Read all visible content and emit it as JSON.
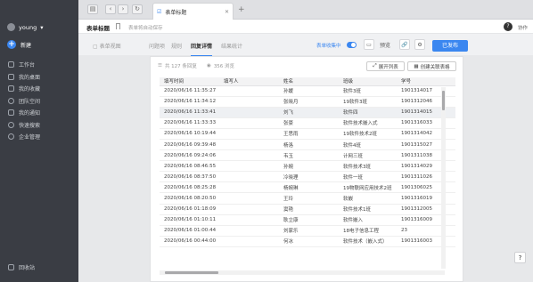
{
  "sidebar": {
    "username": "young",
    "new_label": "新建",
    "items": [
      {
        "label": "工作台",
        "icon": "workbench-icon"
      },
      {
        "label": "我的桌面",
        "icon": "desktop-icon"
      },
      {
        "label": "我的收藏",
        "icon": "star-icon"
      },
      {
        "label": "团队空间",
        "icon": "team-icon"
      },
      {
        "label": "我的通知",
        "icon": "bell-icon"
      },
      {
        "label": "快速搜索",
        "icon": "search-icon"
      },
      {
        "label": "企业管理",
        "icon": "gear-icon"
      }
    ],
    "recycle_label": "回收站"
  },
  "topbar": {
    "tab_title": "表单标题"
  },
  "header": {
    "form_title": "表单标题",
    "autosave": "表单将自动保存",
    "collab": "协作"
  },
  "subbar": {
    "tabs": [
      "表单视图",
      "问题项",
      "规则",
      "回复详情",
      "结果统计"
    ],
    "status": "表单收集中",
    "preview": "预览",
    "publish": "已发布"
  },
  "panel": {
    "total": "共 127 条回复",
    "views": "356 浏览",
    "expand": "展开列表",
    "create_table": "创建关联表格"
  },
  "table": {
    "columns": [
      "填写时间",
      "填写人",
      "姓名",
      "班级",
      "学号"
    ],
    "rows": [
      [
        "2020/06/16 11:35:27",
        "",
        "孙媛",
        "软件3班",
        "1901314017"
      ],
      [
        "2020/06/16 11:34:12",
        "",
        "张晓月",
        "19软件3班",
        "1901312046"
      ],
      [
        "2020/06/16 11:33:41",
        "",
        "刘飞",
        "软件四",
        "1901314015"
      ],
      [
        "2020/06/16 11:33:33",
        "",
        "张豪",
        "软件技术嵌入式",
        "1901316033"
      ],
      [
        "2020/06/16 10:19:44",
        "",
        "王思雨",
        "19软件技术2班",
        "1901314042"
      ],
      [
        "2020/06/16 09:39:48",
        "",
        "杨洛",
        "软件4班",
        "1901315027"
      ],
      [
        "2020/06/16 09:24:06",
        "",
        "韦玉",
        "计网三班",
        "1901311038"
      ],
      [
        "2020/06/16 08:46:55",
        "",
        "孙婉",
        "软件技术3班",
        "1901314029"
      ],
      [
        "2020/06/16 08:37:50",
        "",
        "冷晓理",
        "软件一班",
        "1901311026"
      ],
      [
        "2020/06/16 08:25:28",
        "",
        "杨婉琳",
        "19物联网应用技术2班",
        "1901306025"
      ],
      [
        "2020/06/16 08:20:50",
        "",
        "王玲",
        "软嵌",
        "1901316019"
      ],
      [
        "2020/06/16 01:18:09",
        "",
        "窦艳",
        "软件技术1班",
        "1901312005"
      ],
      [
        "2020/06/16 01:10:11",
        "",
        "耿立康",
        "软件嵌入",
        "1901316009"
      ],
      [
        "2020/06/16 01:00:44",
        "",
        "刘家乐",
        "18电子信息工程",
        "23"
      ],
      [
        "2020/06/16 00:44:00",
        "",
        "何冰",
        "软件技术（嵌入式）",
        "1901316003"
      ]
    ]
  }
}
